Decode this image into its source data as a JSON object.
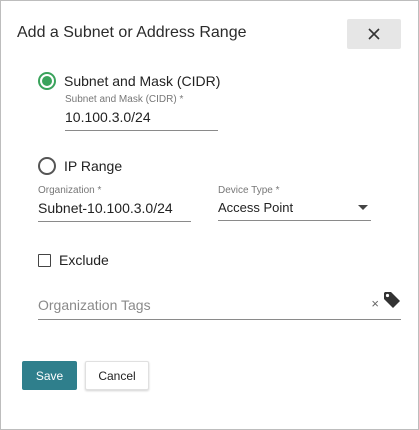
{
  "dialog": {
    "title": "Add a Subnet or Address Range"
  },
  "subnet_option": {
    "label": "Subnet and Mask (CIDR)",
    "selected": true,
    "field_label": "Subnet and Mask (CIDR) *",
    "field_value": "10.100.3.0/24"
  },
  "ip_range_option": {
    "label": "IP Range",
    "selected": false
  },
  "organization": {
    "label": "Organization *",
    "value": "Subnet-10.100.3.0/24"
  },
  "device_type": {
    "label": "Device Type *",
    "value": "Access Point"
  },
  "exclude": {
    "label": "Exclude",
    "checked": false
  },
  "tags": {
    "placeholder": "Organization Tags",
    "clear_glyph": "×"
  },
  "buttons": {
    "save": "Save",
    "cancel": "Cancel"
  },
  "colors": {
    "accent_green": "#3aa35c",
    "save_teal": "#2f7f8c",
    "close_bg": "#e6e6e6"
  },
  "icons": {
    "close": "close-icon",
    "tag": "tag-icon",
    "dropdown": "chevron-down-icon"
  }
}
